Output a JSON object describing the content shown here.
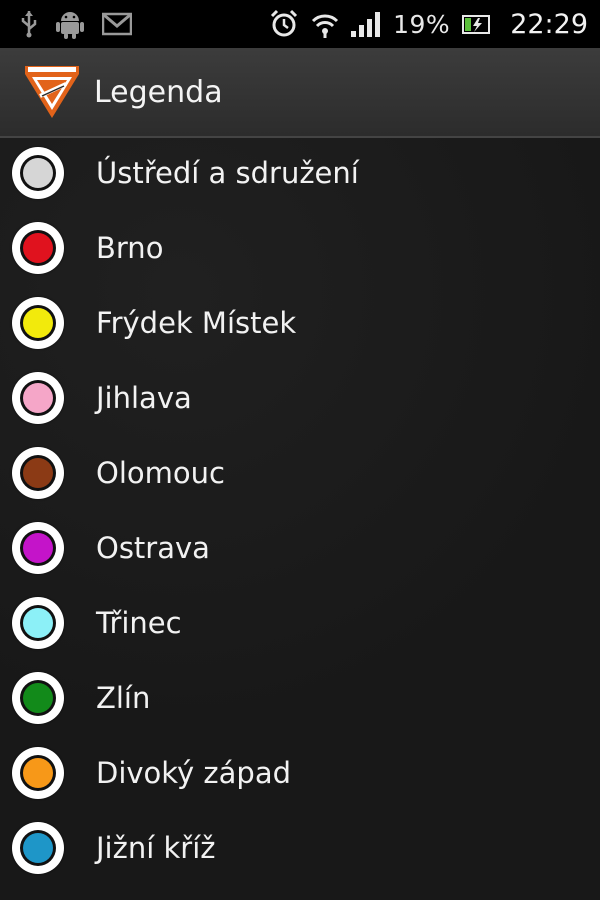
{
  "status_bar": {
    "icons_left": [
      "usb-icon",
      "android-debug-icon",
      "gmail-icon"
    ],
    "icons_right": [
      "alarm-clock-icon",
      "wifi-icon",
      "signal-icon",
      "battery-charging-icon"
    ],
    "battery": "19%",
    "time": "22:29"
  },
  "action_bar": {
    "title": "Legenda",
    "logo": "app-badge-icon"
  },
  "legend": {
    "items": [
      {
        "label": "Ústředí a sdružení",
        "color": "#d6d6d6"
      },
      {
        "label": "Brno",
        "color": "#e0121e"
      },
      {
        "label": "Frýdek Místek",
        "color": "#f2ea0c"
      },
      {
        "label": "Jihlava",
        "color": "#f5a6c8"
      },
      {
        "label": "Olomouc",
        "color": "#8b3a15"
      },
      {
        "label": "Ostrava",
        "color": "#c414c9"
      },
      {
        "label": "Třinec",
        "color": "#8cf0f7"
      },
      {
        "label": "Zlín",
        "color": "#128a1a"
      },
      {
        "label": "Divoký západ",
        "color": "#f79818"
      },
      {
        "label": "Jižní kříž",
        "color": "#1e96c8"
      }
    ]
  }
}
